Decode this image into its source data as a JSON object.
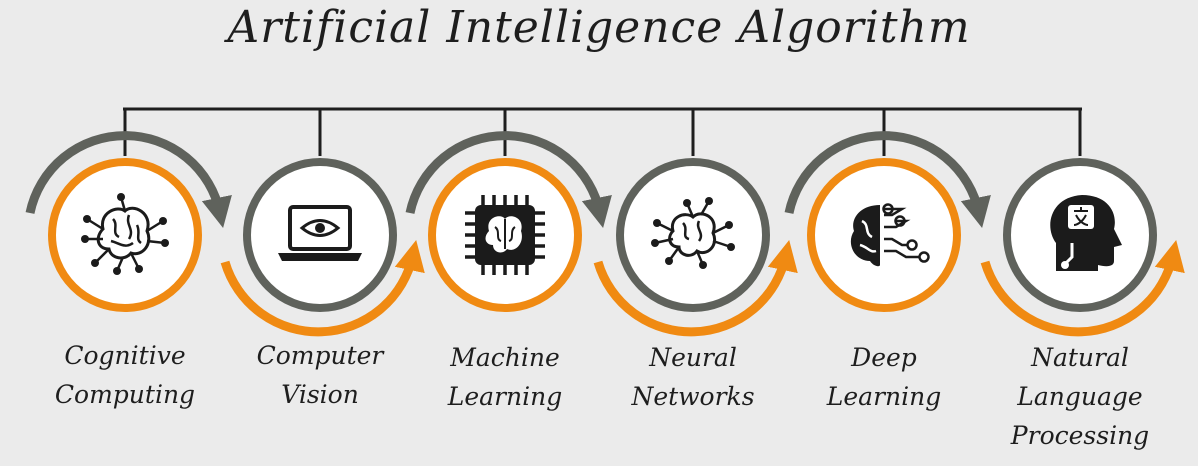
{
  "title": "Artificial Intelligence Algorithm",
  "colors": {
    "orange": "#f08a12",
    "gray": "#5f625c",
    "line": "#1e1e1e",
    "icon": "#1b1b1b",
    "background": "#ebebeb"
  },
  "nodes": [
    {
      "icon": "brain-circuit-icon",
      "ring": "orange",
      "label_lines": [
        "Cognitive",
        "Computing"
      ]
    },
    {
      "icon": "laptop-eye-icon",
      "ring": "gray",
      "label_lines": [
        "Computer",
        "Vision"
      ]
    },
    {
      "icon": "brain-chip-icon",
      "ring": "orange",
      "label_lines": [
        "Machine",
        "Learning"
      ]
    },
    {
      "icon": "brain-network-icon",
      "ring": "gray",
      "label_lines": [
        "Neural",
        "Networks"
      ]
    },
    {
      "icon": "half-brain-circuit-icon",
      "ring": "orange",
      "label_lines": [
        "Deep",
        "Learning"
      ]
    },
    {
      "icon": "head-language-icon",
      "ring": "gray",
      "label_lines": [
        "Natural",
        "Language",
        "Processing"
      ]
    }
  ]
}
